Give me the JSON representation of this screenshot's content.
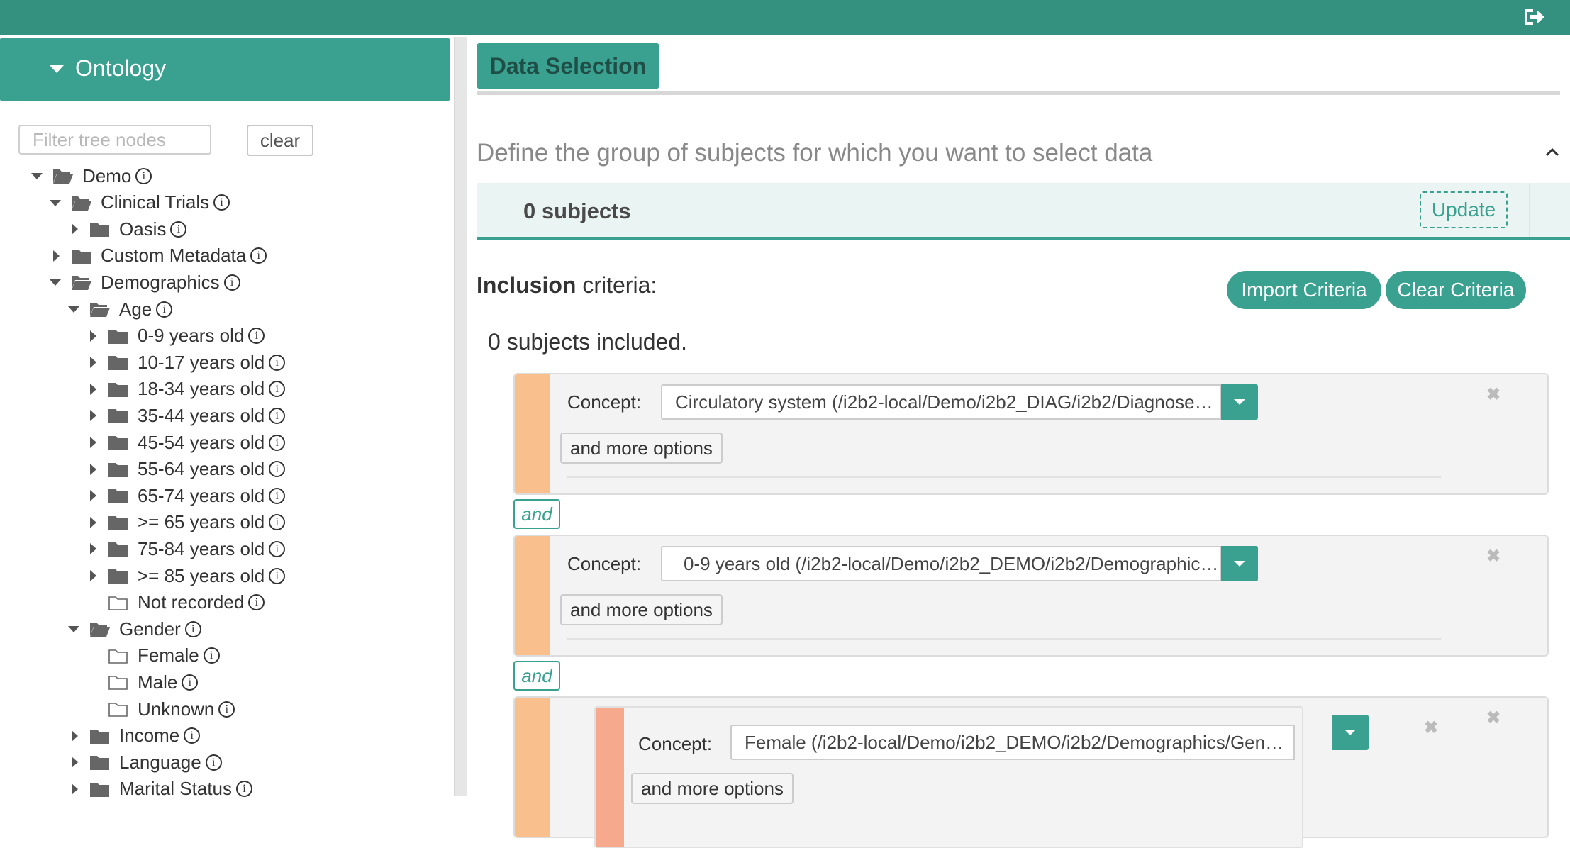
{
  "sidebar": {
    "title": "Ontology",
    "filter_placeholder": "Filter tree nodes",
    "clear_label": "clear",
    "info_glyph": "i",
    "tree": [
      {
        "label": "Demo",
        "toggle": "open",
        "folder": "open",
        "depth": 0,
        "info": true
      },
      {
        "label": "Clinical Trials",
        "toggle": "open",
        "folder": "open",
        "depth": 1,
        "info": true
      },
      {
        "label": "Oasis",
        "toggle": "closed",
        "folder": "closed",
        "depth": 2,
        "info": true
      },
      {
        "label": "Custom Metadata",
        "toggle": "closed",
        "folder": "closed",
        "depth": 1,
        "info": true
      },
      {
        "label": "Demographics",
        "toggle": "open",
        "folder": "open",
        "depth": 1,
        "info": true
      },
      {
        "label": "Age",
        "toggle": "open",
        "folder": "open",
        "depth": 2,
        "info": true
      },
      {
        "label": "0-9 years old",
        "toggle": "closed",
        "folder": "closed",
        "depth": 3,
        "info": true
      },
      {
        "label": "10-17 years old",
        "toggle": "closed",
        "folder": "closed",
        "depth": 3,
        "info": true
      },
      {
        "label": "18-34 years old",
        "toggle": "closed",
        "folder": "closed",
        "depth": 3,
        "info": true
      },
      {
        "label": "35-44 years old",
        "toggle": "closed",
        "folder": "closed",
        "depth": 3,
        "info": true
      },
      {
        "label": "45-54 years old",
        "toggle": "closed",
        "folder": "closed",
        "depth": 3,
        "info": true
      },
      {
        "label": "55-64 years old",
        "toggle": "closed",
        "folder": "closed",
        "depth": 3,
        "info": true
      },
      {
        "label": "65-74 years old",
        "toggle": "closed",
        "folder": "closed",
        "depth": 3,
        "info": true
      },
      {
        "label": ">= 65 years old",
        "toggle": "closed",
        "folder": "closed",
        "depth": 3,
        "info": true
      },
      {
        "label": "75-84 years old",
        "toggle": "closed",
        "folder": "closed",
        "depth": 3,
        "info": true
      },
      {
        "label": ">= 85 years old",
        "toggle": "closed",
        "folder": "closed",
        "depth": 3,
        "info": true
      },
      {
        "label": "Not recorded",
        "toggle": "none",
        "folder": "leaf",
        "depth": 3,
        "info": true
      },
      {
        "label": "Gender",
        "toggle": "open",
        "folder": "open",
        "depth": 2,
        "info": true
      },
      {
        "label": "Female",
        "toggle": "none",
        "folder": "leaf",
        "depth": 3,
        "info": true
      },
      {
        "label": "Male",
        "toggle": "none",
        "folder": "leaf",
        "depth": 3,
        "info": true
      },
      {
        "label": "Unknown",
        "toggle": "none",
        "folder": "leaf",
        "depth": 3,
        "info": true
      },
      {
        "label": "Income",
        "toggle": "closed",
        "folder": "closed",
        "depth": 2,
        "info": true
      },
      {
        "label": "Language",
        "toggle": "closed",
        "folder": "closed",
        "depth": 2,
        "info": true
      },
      {
        "label": "Marital Status",
        "toggle": "closed",
        "folder": "closed",
        "depth": 2,
        "info": true
      }
    ]
  },
  "main": {
    "tab_label": "Data Selection",
    "define_heading": "Define the group of subjects for which you want to select data",
    "subject_count": "0 subjects",
    "update_label": "Update",
    "inclusion_bold": "Inclusion",
    "inclusion_rest": " criteria:",
    "import_label": "Import Criteria",
    "clear_criteria_label": "Clear Criteria",
    "subjects_included": "0 subjects included.",
    "and_label": "and",
    "concept_label": "Concept:",
    "more_options_label": "and more options",
    "remove_glyph": "✖",
    "criteria": [
      {
        "concept": "Circulatory system (/i2b2-local/Demo/i2b2_DIAG/i2b2/Diagnoses/...)"
      },
      {
        "concept": "0-9 years old (/i2b2-local/Demo/i2b2_DEMO/i2b2/Demographics/...)"
      },
      {
        "concept": "Female (/i2b2-local/Demo/i2b2_DEMO/i2b2/Demographics/Gender/...)"
      }
    ]
  },
  "colors": {
    "topbar": "#34907f",
    "accent": "#3aa08f",
    "criterion_bar": "#f9c08e",
    "nested_bar": "#f6a98c"
  },
  "icons": [
    "logout-icon",
    "caret-down-icon",
    "folder-open-icon",
    "folder-closed-icon",
    "file-icon",
    "info-icon",
    "chevron-up-icon",
    "close-icon"
  ]
}
